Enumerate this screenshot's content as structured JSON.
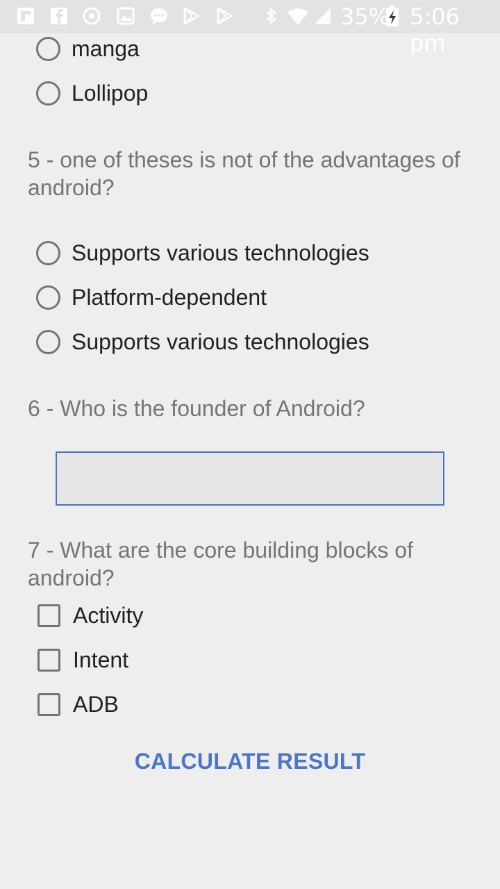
{
  "status_bar": {
    "battery": "35%",
    "time": "5:06 pm",
    "icons": [
      "flipboard-icon",
      "facebook-icon",
      "sync-icon",
      "image-icon",
      "chat-icon",
      "play-store-icon",
      "play-store-icon",
      "bluetooth-icon",
      "wifi-icon",
      "signal-icon",
      "battery-charging-icon"
    ]
  },
  "q4": {
    "options": [
      "manga",
      "Lollipop"
    ]
  },
  "q5": {
    "question": "5 - one of theses is not of the advantages of android?",
    "options": [
      "Supports various technologies",
      "Platform-dependent",
      "Supports various technologies"
    ]
  },
  "q6": {
    "question": "6 - Who is the founder of Android?",
    "answer_value": "",
    "placeholder": ""
  },
  "q7": {
    "question": "7 - What are the core building blocks of android?",
    "options": [
      "Activity",
      "Intent",
      "ADB"
    ]
  },
  "calculate_button": "CALCULATE RESULT",
  "colors": {
    "background": "#eeeeee",
    "accent": "#4c76c7",
    "question_text": "#757575",
    "option_text": "#212121"
  }
}
